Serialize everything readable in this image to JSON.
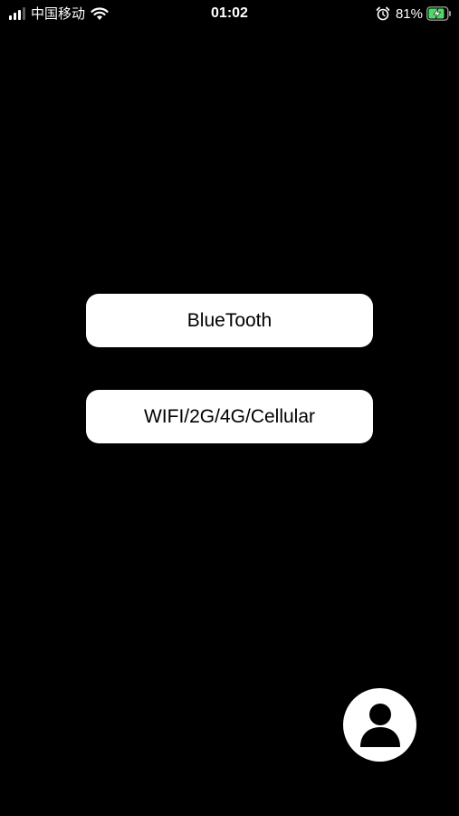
{
  "status_bar": {
    "carrier": "中国移动",
    "time": "01:02",
    "battery_percent": "81%",
    "signal_bars": 3,
    "icons": [
      "signal-icon",
      "wifi-icon",
      "alarm-icon",
      "battery-charging-icon"
    ]
  },
  "main": {
    "bluetooth_label": "BlueTooth",
    "network_label": "WIFI/2G/4G/Cellular"
  },
  "fab": {
    "icon": "person-icon"
  },
  "colors": {
    "background": "#000000",
    "button_bg": "#ffffff",
    "button_text": "#000000",
    "battery_charge": "#4cd964"
  }
}
